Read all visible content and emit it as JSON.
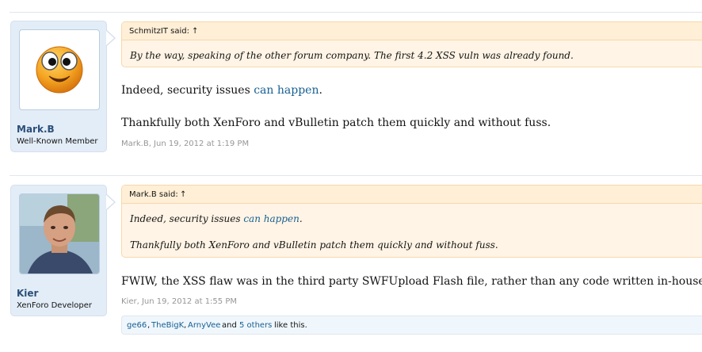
{
  "posts": [
    {
      "username": "Mark.B",
      "user_title": "Well-Known Member",
      "quote": {
        "author_said": "SchmitzIT said:",
        "arrow": "↑",
        "lines": [
          "By the way, speaking of the other forum company. The first 4.2 XSS vuln was already found."
        ]
      },
      "message": {
        "p1_before": "Indeed, security issues ",
        "p1_link": "can happen",
        "p1_after": ".",
        "p2": "Thankfully both XenForo and vBulletin patch them quickly and without fuss."
      },
      "meta": "Mark.B, Jun 19, 2012 at 1:19 PM"
    },
    {
      "username": "Kier",
      "user_title": "XenForo Developer",
      "quote": {
        "author_said": "Mark.B said:",
        "arrow": "↑",
        "line1_before": "Indeed, security issues ",
        "line1_link": "can happen",
        "line1_after": ".",
        "line2": "Thankfully both XenForo and vBulletin patch them quickly and without fuss."
      },
      "message": {
        "p1": "FWIW, the XSS flaw was in the third party SWFUpload Flash file, rather than any code written in-house."
      },
      "meta": "Kier, Jun 19, 2012 at 1:55 PM",
      "likes": {
        "users": [
          "ge66",
          "TheBigK",
          "ArnyVee"
        ],
        "sep": ",",
        "and": "and",
        "others": "5 others",
        "suffix": "like this."
      }
    }
  ],
  "colors": {
    "link": "#176093",
    "username": "#2b4f7a",
    "quote_bg": "#fff4e5",
    "user_block_bg": "#e3edf7"
  }
}
